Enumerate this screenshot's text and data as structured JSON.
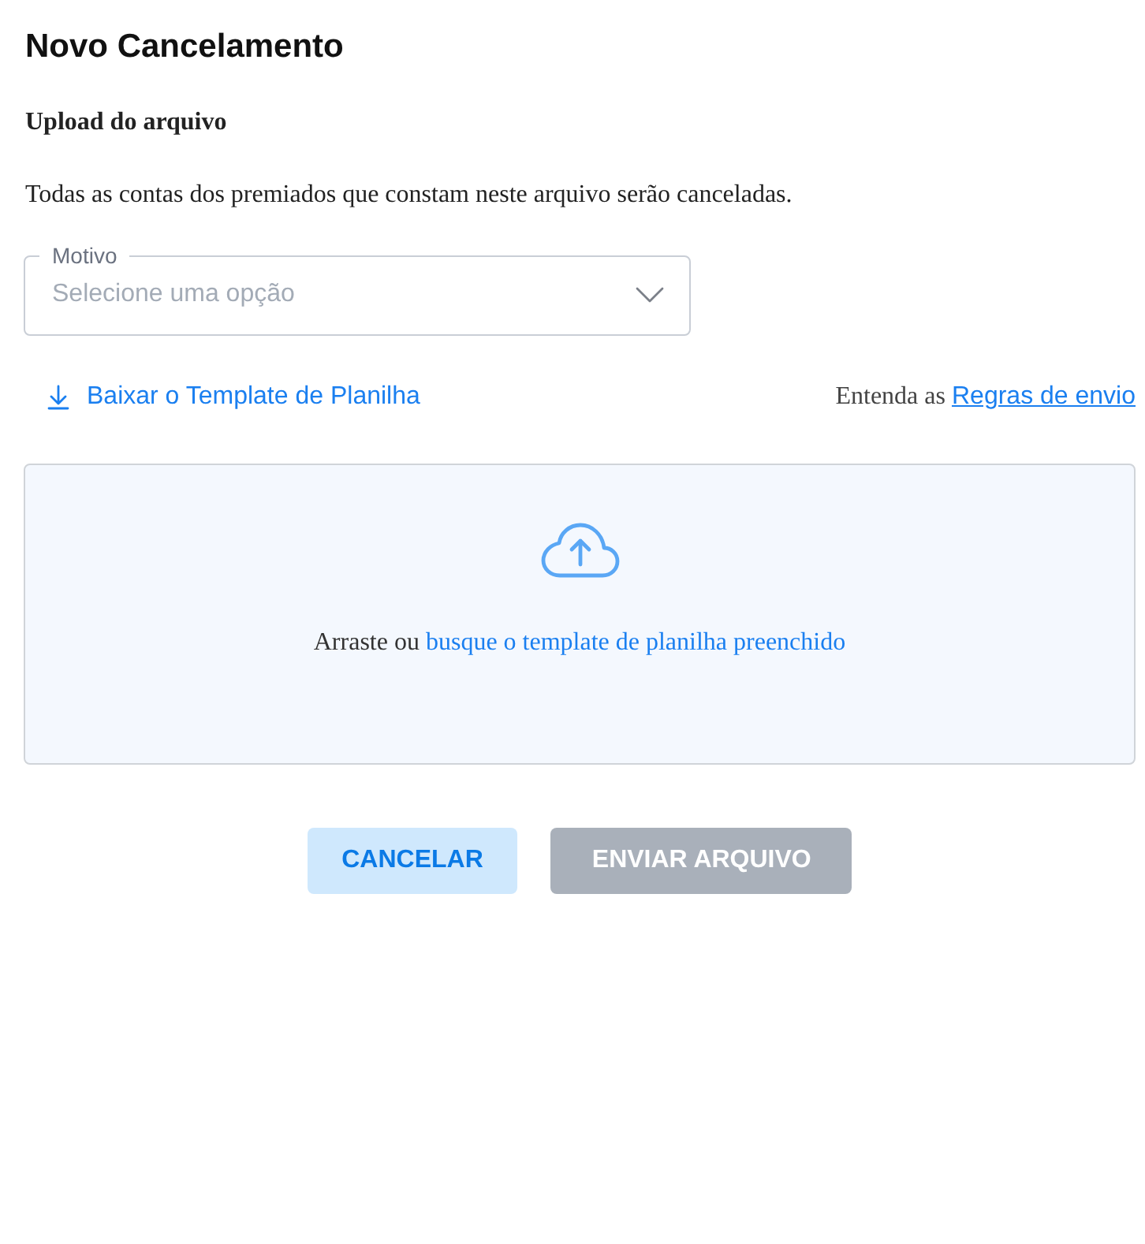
{
  "page": {
    "title": "Novo Cancelamento"
  },
  "upload": {
    "heading": "Upload do arquivo",
    "description": "Todas as contas dos premiados que constam neste arquivo serão canceladas."
  },
  "reason_select": {
    "label": "Motivo",
    "placeholder": "Selecione uma opção"
  },
  "template_link": {
    "label": "Baixar o Template de Planilha"
  },
  "rules": {
    "text": "Entenda as",
    "link": "Regras de envio"
  },
  "dropzone": {
    "text": "Arraste ou",
    "link": "busque o template de planilha preenchido"
  },
  "buttons": [
    {
      "label": "CANCELAR",
      "kind": "secondary",
      "disabled": false
    },
    {
      "label": "ENVIAR ARQUIVO",
      "kind": "primary",
      "disabled": true
    }
  ]
}
